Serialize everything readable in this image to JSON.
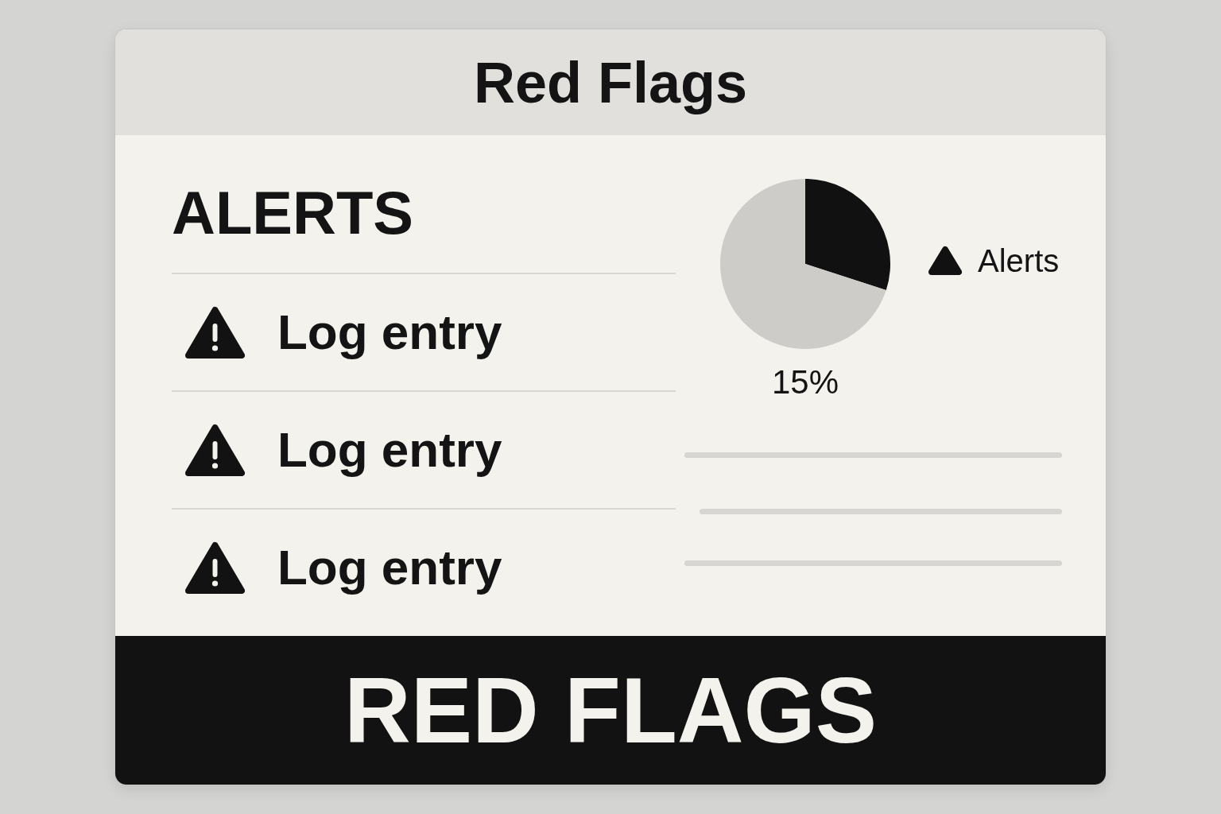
{
  "header": {
    "title": "Red Flags"
  },
  "alerts": {
    "heading": "ALERTS",
    "entries": [
      {
        "label": "Log entry"
      },
      {
        "label": "Log entry"
      },
      {
        "label": "Log entry"
      }
    ]
  },
  "chart": {
    "chart_data": {
      "type": "pie",
      "values": [
        30,
        70
      ]
    },
    "legend": [
      {
        "label": "Alerts",
        "color": "#111111"
      }
    ],
    "value_label": "15%"
  },
  "footer": {
    "banner": "RED FLAGS"
  }
}
